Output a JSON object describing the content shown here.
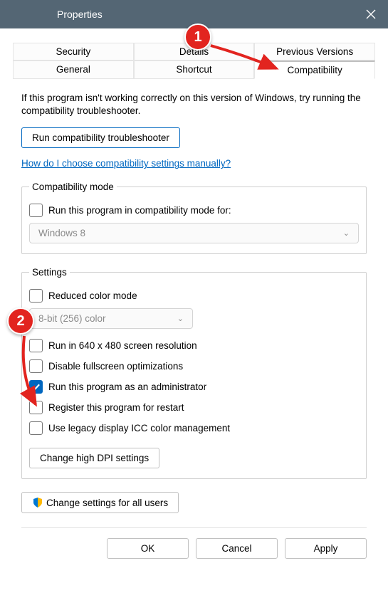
{
  "titlebar": {
    "text": "Properties"
  },
  "tabs": {
    "row1": [
      "Security",
      "Details",
      "Previous Versions"
    ],
    "row2": [
      "General",
      "Shortcut",
      "Compatibility"
    ],
    "active": "Compatibility"
  },
  "intro": "If this program isn't working correctly on this version of Windows, try running the compatibility troubleshooter.",
  "buttons": {
    "run_troubleshooter": "Run compatibility troubleshooter",
    "change_dpi": "Change high DPI settings",
    "change_all_users": "Change settings for all users",
    "ok": "OK",
    "cancel": "Cancel",
    "apply": "Apply"
  },
  "link": "How do I choose compatibility settings manually?",
  "compat_mode": {
    "legend": "Compatibility mode",
    "checkbox_label": "Run this program in compatibility mode for:",
    "select_value": "Windows 8"
  },
  "settings": {
    "legend": "Settings",
    "reduced_color": "Reduced color mode",
    "color_select": "8-bit (256) color",
    "run_640": "Run in 640 x 480 screen resolution",
    "disable_fullscreen": "Disable fullscreen optimizations",
    "run_admin": "Run this program as an administrator",
    "register_restart": "Register this program for restart",
    "legacy_icc": "Use legacy display ICC color management"
  },
  "annotations": {
    "1": "1",
    "2": "2"
  }
}
